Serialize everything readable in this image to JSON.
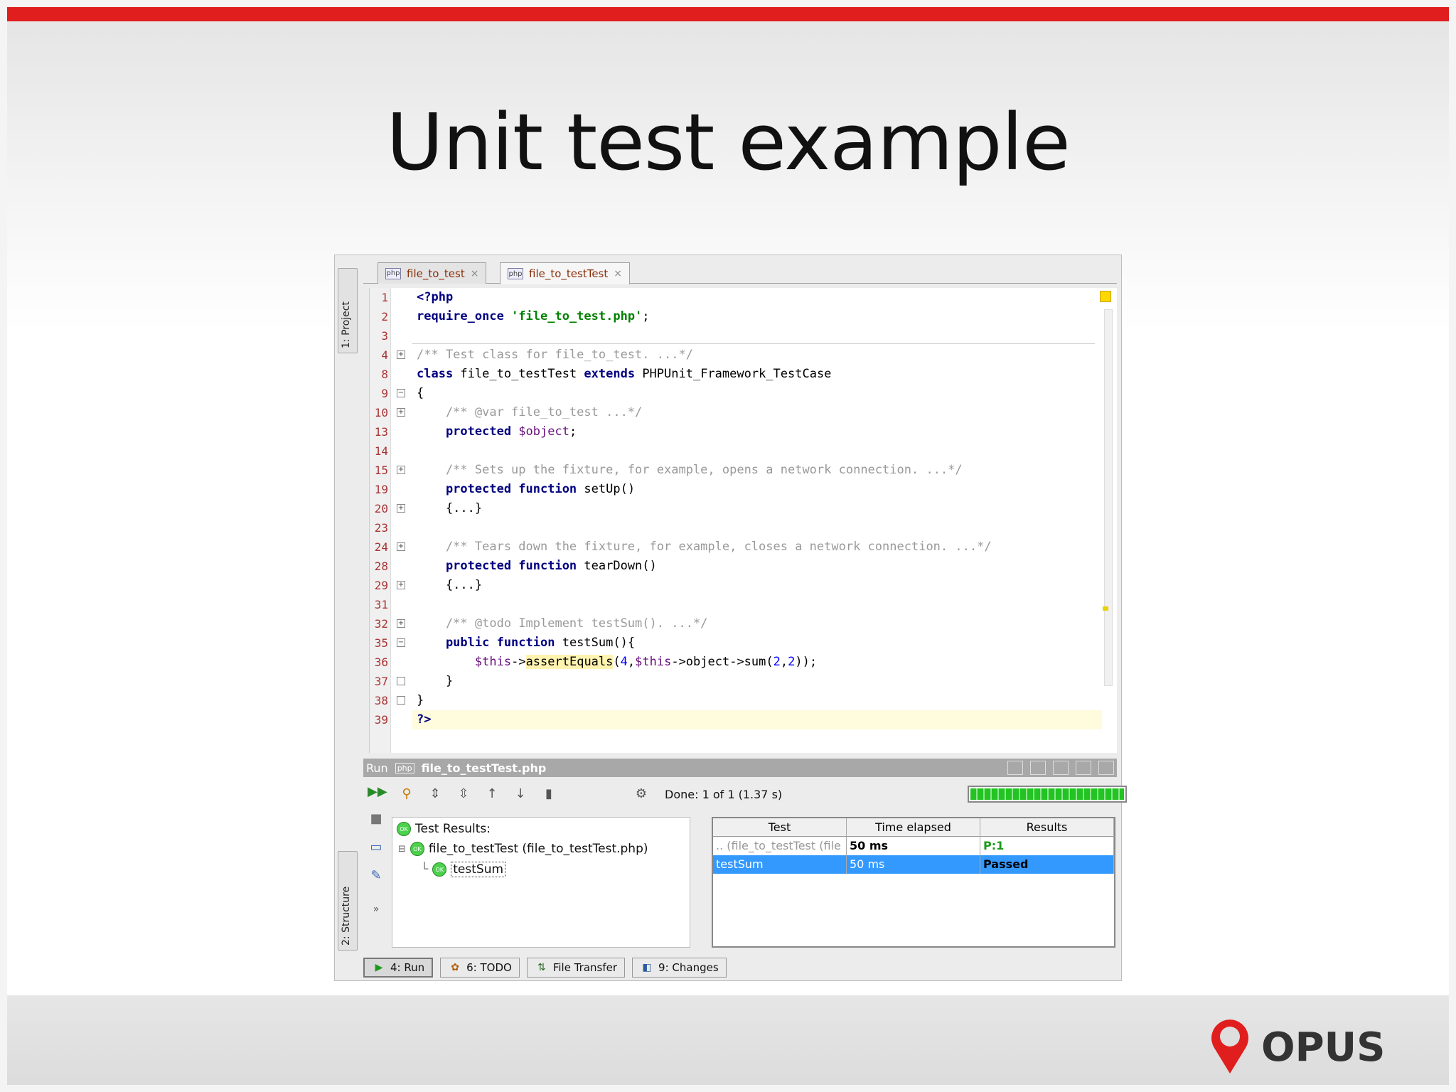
{
  "slide": {
    "title": "Unit test example",
    "brand_color": "#e01e1e",
    "logo_text": "OPUS"
  },
  "ide": {
    "side_tabs": {
      "project": "1: Project",
      "structure": "2: Structure"
    },
    "tabs": [
      {
        "label": "file_to_test",
        "icon": "php-file-icon",
        "active": false
      },
      {
        "label": "file_to_testTest",
        "icon": "php-file-icon",
        "active": true
      }
    ],
    "editor": {
      "lines": [
        {
          "num": "1",
          "segments": [
            {
              "t": "<?php",
              "c": "kw"
            }
          ]
        },
        {
          "num": "2",
          "segments": [
            {
              "t": "require_once ",
              "c": "kw"
            },
            {
              "t": "'file_to_test.php'",
              "c": "str"
            },
            {
              "t": ";",
              "c": ""
            }
          ]
        },
        {
          "num": "3",
          "segments": []
        },
        {
          "num": "4",
          "segments": [
            {
              "t": "/** Test class for file_to_test. ...*/",
              "c": "cm"
            }
          ],
          "fold": "+"
        },
        {
          "num": "8",
          "segments": [
            {
              "t": "class ",
              "c": "kw"
            },
            {
              "t": "file_to_testTest ",
              "c": ""
            },
            {
              "t": "extends ",
              "c": "kw"
            },
            {
              "t": "PHPUnit_Framework_TestCase",
              "c": ""
            }
          ]
        },
        {
          "num": "9",
          "segments": [
            {
              "t": "{",
              "c": ""
            }
          ],
          "fold": "-"
        },
        {
          "num": "10",
          "segments": [
            {
              "t": "    /** @var file_to_test ...*/",
              "c": "cm"
            }
          ],
          "fold": "+"
        },
        {
          "num": "13",
          "segments": [
            {
              "t": "    protected ",
              "c": "kw"
            },
            {
              "t": "$object",
              "c": "var"
            },
            {
              "t": ";",
              "c": ""
            }
          ]
        },
        {
          "num": "14",
          "segments": []
        },
        {
          "num": "15",
          "segments": [
            {
              "t": "    /** Sets up the fixture, for example, opens a network connection. ...*/",
              "c": "cm"
            }
          ],
          "fold": "+"
        },
        {
          "num": "19",
          "segments": [
            {
              "t": "    protected function ",
              "c": "kw"
            },
            {
              "t": "setUp()",
              "c": ""
            }
          ]
        },
        {
          "num": "20",
          "segments": [
            {
              "t": "    {...}",
              "c": ""
            }
          ],
          "fold": "+"
        },
        {
          "num": "23",
          "segments": []
        },
        {
          "num": "24",
          "segments": [
            {
              "t": "    /** Tears down the fixture, for example, closes a network connection. ...*/",
              "c": "cm"
            }
          ],
          "fold": "+"
        },
        {
          "num": "28",
          "segments": [
            {
              "t": "    protected function ",
              "c": "kw"
            },
            {
              "t": "tearDown()",
              "c": ""
            }
          ]
        },
        {
          "num": "29",
          "segments": [
            {
              "t": "    {...}",
              "c": ""
            }
          ],
          "fold": "+"
        },
        {
          "num": "31",
          "segments": []
        },
        {
          "num": "32",
          "segments": [
            {
              "t": "    /** @todo Implement testSum(). ...*/",
              "c": "cm"
            }
          ],
          "fold": "+"
        },
        {
          "num": "35",
          "segments": [
            {
              "t": "    public function ",
              "c": "kw"
            },
            {
              "t": "testSum(){",
              "c": ""
            }
          ],
          "fold": "-"
        },
        {
          "num": "36",
          "segments": [
            {
              "t": "        ",
              "c": ""
            },
            {
              "t": "$this",
              "c": "var"
            },
            {
              "t": "->",
              "c": ""
            },
            {
              "t": "assertEquals",
              "c": "hl"
            },
            {
              "t": "(",
              "c": ""
            },
            {
              "t": "4",
              "c": "num"
            },
            {
              "t": ",",
              "c": ""
            },
            {
              "t": "$this",
              "c": "var"
            },
            {
              "t": "->object->sum(",
              "c": ""
            },
            {
              "t": "2",
              "c": "num"
            },
            {
              "t": ",",
              "c": ""
            },
            {
              "t": "2",
              "c": "num"
            },
            {
              "t": "));",
              "c": ""
            }
          ]
        },
        {
          "num": "37",
          "segments": [
            {
              "t": "    }",
              "c": ""
            }
          ],
          "fold": "e"
        },
        {
          "num": "38",
          "segments": [
            {
              "t": "}",
              "c": ""
            }
          ],
          "fold": "e"
        },
        {
          "num": "39",
          "segments": [
            {
              "t": "?>",
              "c": "kw"
            }
          ]
        }
      ]
    },
    "run_panel": {
      "label": "Run",
      "file": "file_to_testTest.php",
      "status": "Done: 1 of 1  (1.37 s)",
      "progress": 1.0,
      "tree": {
        "root": "Test Results:",
        "suite": "file_to_testTest (file_to_testTest.php)",
        "test": "testSum"
      },
      "results": {
        "headers": [
          "Test",
          "Time elapsed",
          "Results"
        ],
        "rows": [
          {
            "test": ".. (file_to_testTest (file",
            "time": "50 ms",
            "result": "P:1"
          },
          {
            "test": "testSum",
            "time": "50 ms",
            "result": "Passed"
          }
        ]
      }
    },
    "bottom_tabs": [
      {
        "label": "4: Run",
        "icon": "run-icon"
      },
      {
        "label": "6: TODO",
        "icon": "todo-icon"
      },
      {
        "label": "File Transfer",
        "icon": "file-transfer-icon"
      },
      {
        "label": "9: Changes",
        "icon": "changes-icon"
      }
    ]
  }
}
